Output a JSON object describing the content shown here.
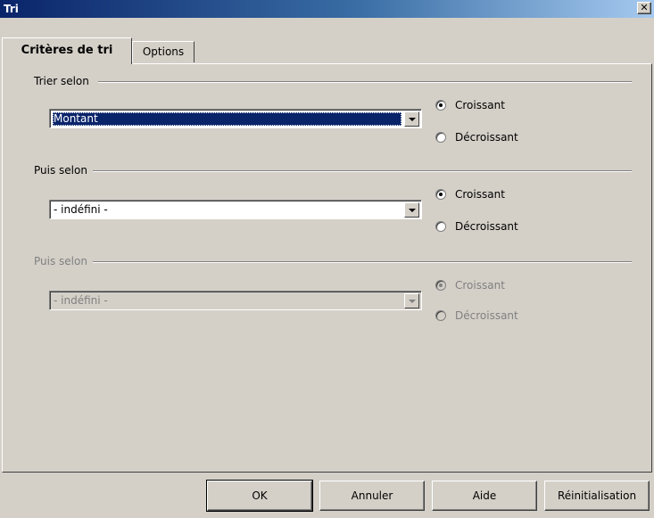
{
  "window": {
    "title": "Tri",
    "close_glyph": "✕"
  },
  "tabs": [
    {
      "label": "Critères de tri",
      "active": true
    },
    {
      "label": "Options",
      "active": false
    }
  ],
  "groups": [
    {
      "label": "Trier selon",
      "mnemonic": "T",
      "combo_value": "Montant",
      "combo_selected": true,
      "disabled": false,
      "radios": [
        {
          "label": "Croissant",
          "checked": true
        },
        {
          "label": "Décroissant",
          "checked": false
        }
      ]
    },
    {
      "label": "Puis selon",
      "mnemonic": "P",
      "combo_value": "- indéfini -",
      "combo_selected": false,
      "disabled": false,
      "radios": [
        {
          "label": "Croissant",
          "checked": true
        },
        {
          "label": "Décroissant",
          "checked": false
        }
      ]
    },
    {
      "label": "Puis selon",
      "mnemonic": "u",
      "combo_value": "- indéfini -",
      "combo_selected": false,
      "disabled": true,
      "radios": [
        {
          "label": "Croissant",
          "checked": true
        },
        {
          "label": "Décroissant",
          "checked": false
        }
      ]
    }
  ],
  "buttons": {
    "ok": "OK",
    "cancel": "Annuler",
    "help": "Aide",
    "reset": "Réinitialisation"
  },
  "icons": {
    "close": "close-icon",
    "dropdown": "chevron-down-icon"
  }
}
